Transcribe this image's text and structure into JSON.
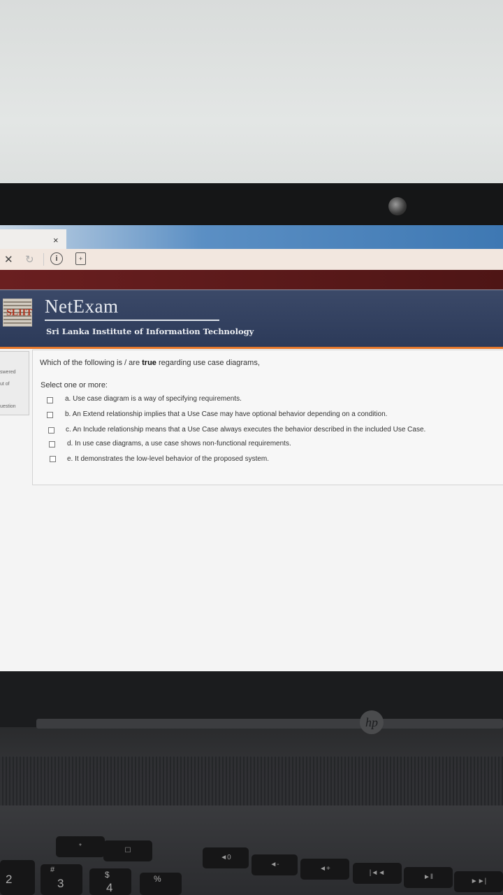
{
  "browser": {
    "tab_close": "×",
    "stop_icon": "close-icon",
    "reload_icon": "reload-icon",
    "info_icon": "info-icon",
    "page_icon": "page-icon"
  },
  "header": {
    "brand": "NetExam",
    "institute": "Sri Lanka Institute of Information Technology",
    "logo_text": "SLIIT"
  },
  "info_panel": {
    "answered": "swered",
    "marked": "ut of",
    "flag": "uestion"
  },
  "question": {
    "text_before": "Which of the following is / are ",
    "text_bold": "true",
    "text_after": " regarding use case diagrams,",
    "select_label": "Select one or more:",
    "options": [
      "a. Use case diagram is a way of specifying requirements.",
      "b. An Extend relationship implies that a Use Case may have optional behavior depending on a condition.",
      "c. An Include relationship means that a Use Case always executes the behavior described in the included Use Case.",
      "d. In use case diagrams, a use case shows non-functional requirements.",
      "e. It demonstrates the low-level behavior of the proposed system."
    ]
  },
  "laptop": {
    "brand": "hp",
    "keys": [
      "*",
      "☐",
      "◄0",
      "◄-",
      "◄+",
      "|◄◄",
      "►‖",
      "►►|"
    ],
    "number_keys": [
      "2",
      "3",
      "#",
      "$",
      "4",
      "%"
    ]
  },
  "colors": {
    "header_bg": "#2c3a59",
    "accent_orange": "#e6782c",
    "brand_red": "#4e1515"
  }
}
